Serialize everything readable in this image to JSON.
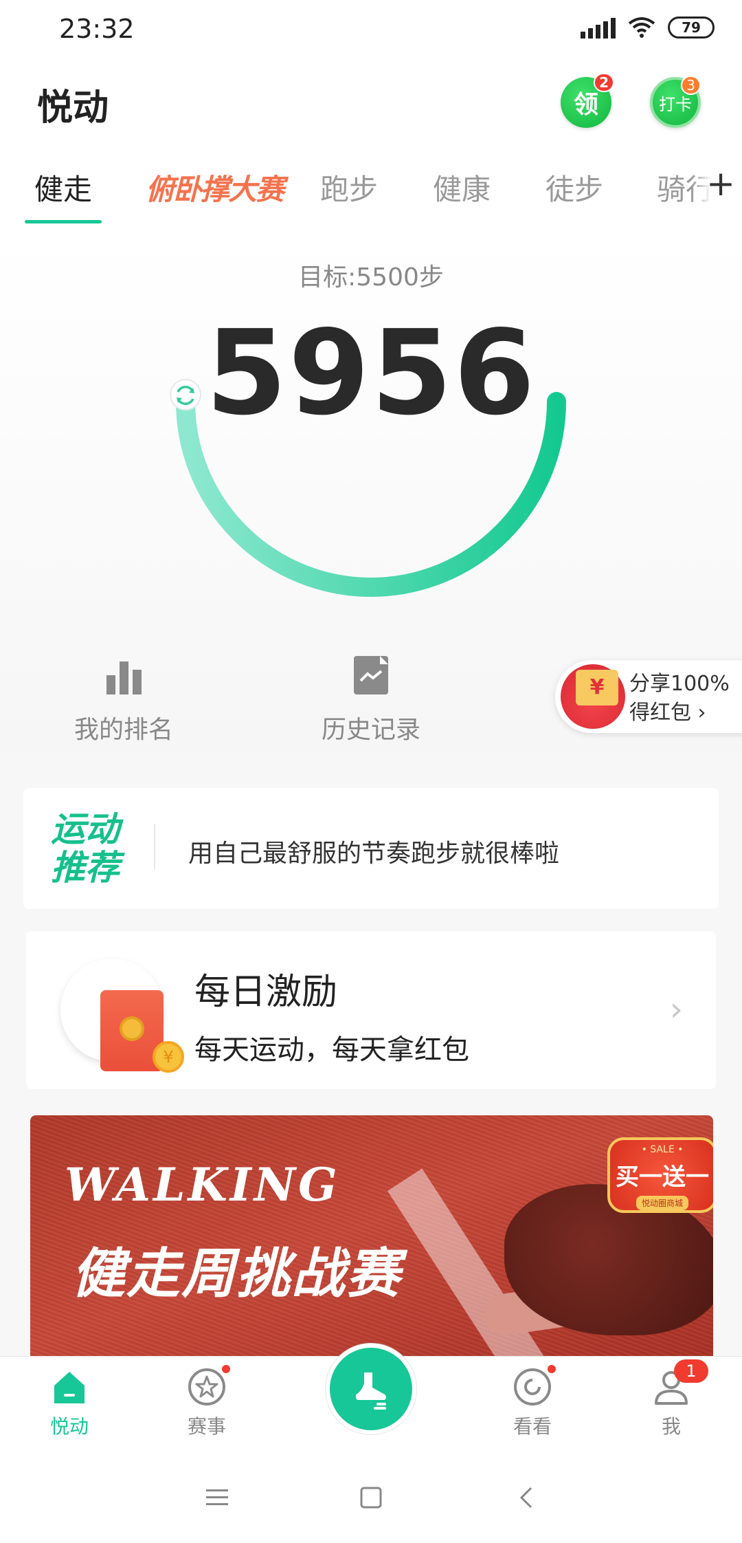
{
  "status_bar": {
    "time": "23:32",
    "battery": "79"
  },
  "header": {
    "title": "悦动",
    "claim_label": "领",
    "claim_badge": "2",
    "checkin_label": "打卡",
    "checkin_badge": "3"
  },
  "tabs": [
    {
      "label": "健走",
      "active": true
    },
    {
      "label": "俯卧撑大赛",
      "promo": true
    },
    {
      "label": "跑步"
    },
    {
      "label": "健康"
    },
    {
      "label": "徒步"
    },
    {
      "label": "骑行"
    }
  ],
  "tabs_plus": "+",
  "steps": {
    "goal": "目标:5500步",
    "count": "5956",
    "goal_value": 5500,
    "count_value": 5956
  },
  "quick_links": {
    "ranking_label": "我的排名",
    "history_label": "历史记录"
  },
  "share": {
    "currency": "¥",
    "line1": "分享100%",
    "line2": "得红包"
  },
  "recommendation": {
    "logo_line1": "运动",
    "logo_line2": "推荐",
    "text": "用自己最舒服的节奏跑步就很棒啦"
  },
  "daily_reward": {
    "title": "每日激励",
    "subtitle": "每天运动，每天拿红包",
    "coin": "¥"
  },
  "banner": {
    "en_title": "WALKING",
    "cn_title": "健走周挑战赛",
    "sale_top": "• SALE •",
    "sale_main": "买一送一",
    "sale_bottom": "悦动圈商城"
  },
  "bottom_nav": {
    "home": "悦动",
    "events": "赛事",
    "watch": "看看",
    "me": "我",
    "me_badge": "1"
  },
  "colors": {
    "accent": "#17c797",
    "promo": "#f4734e",
    "badge_red": "#f03b2e"
  }
}
